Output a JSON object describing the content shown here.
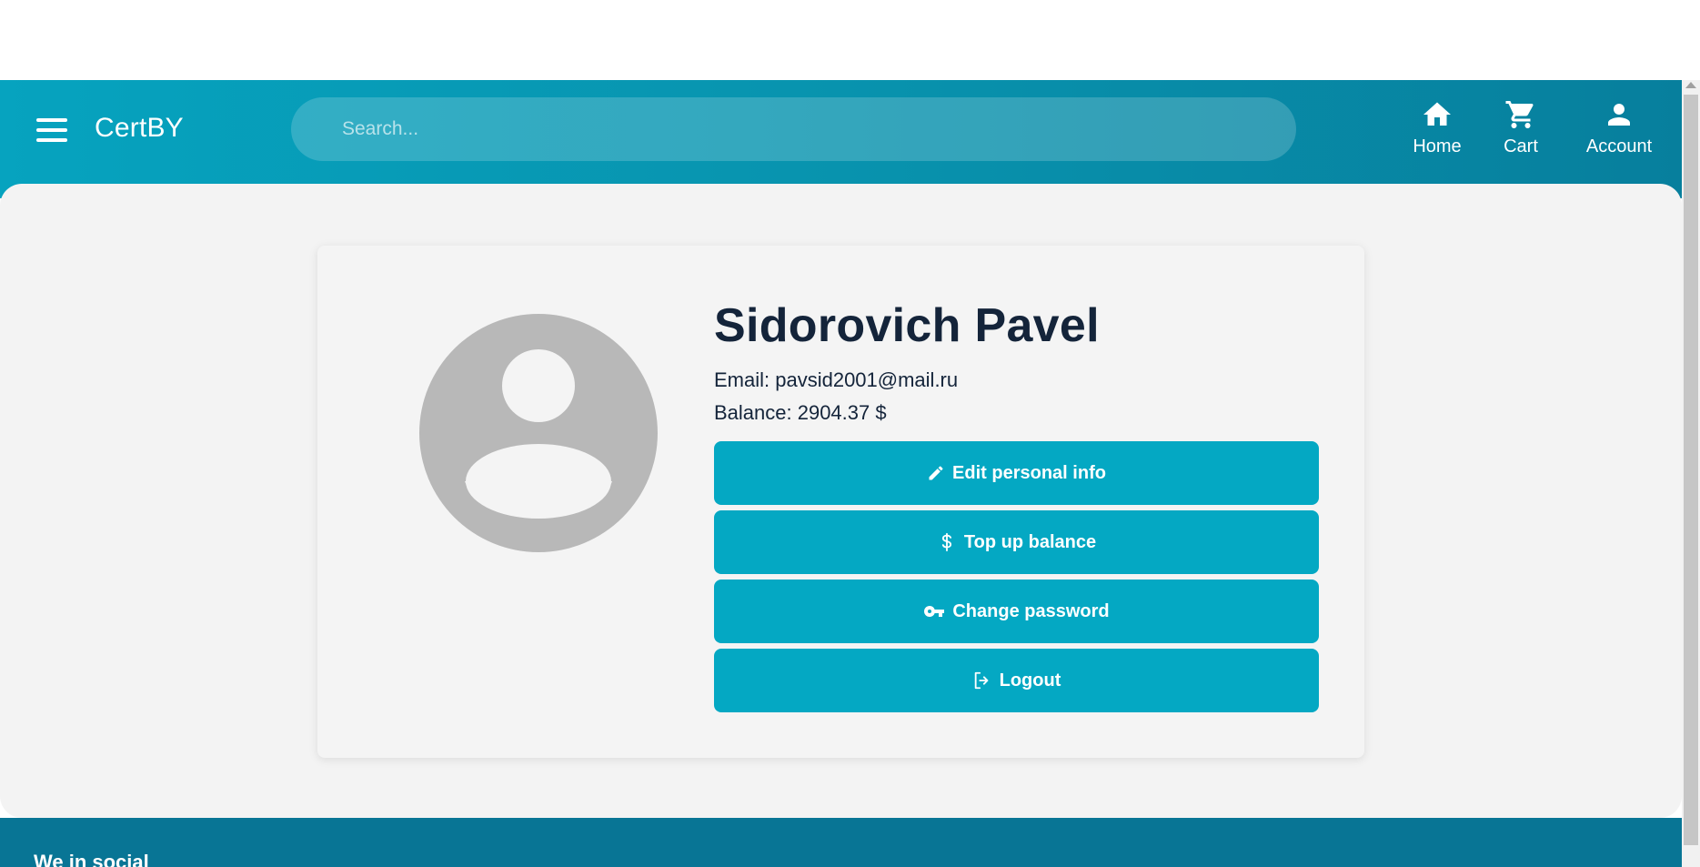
{
  "header": {
    "brand": "CertBY",
    "search_placeholder": "Search...",
    "nav": {
      "home": "Home",
      "cart": "Cart",
      "account": "Account"
    }
  },
  "profile": {
    "name": "Sidorovich Pavel",
    "email_line": "Email: pavsid2001@mail.ru",
    "balance_line": "Balance: 2904.37 $"
  },
  "actions": {
    "edit": "Edit personal info",
    "topup": "Top up balance",
    "password": "Change password",
    "logout": "Logout"
  },
  "footer": {
    "title": "We in social"
  },
  "colors": {
    "accent": "#04a8c3",
    "header_start": "#06a3bf",
    "header_end": "#077f9d",
    "footer": "#087595",
    "text_dark": "#14243a"
  },
  "icons": {
    "menu": "hamburger-menu-icon",
    "home": "home-icon",
    "cart": "cart-icon",
    "account": "account-icon",
    "edit": "pencil-icon",
    "topup": "dollar-icon",
    "password": "key-icon",
    "logout": "logout-icon",
    "avatar": "user-avatar-icon"
  }
}
